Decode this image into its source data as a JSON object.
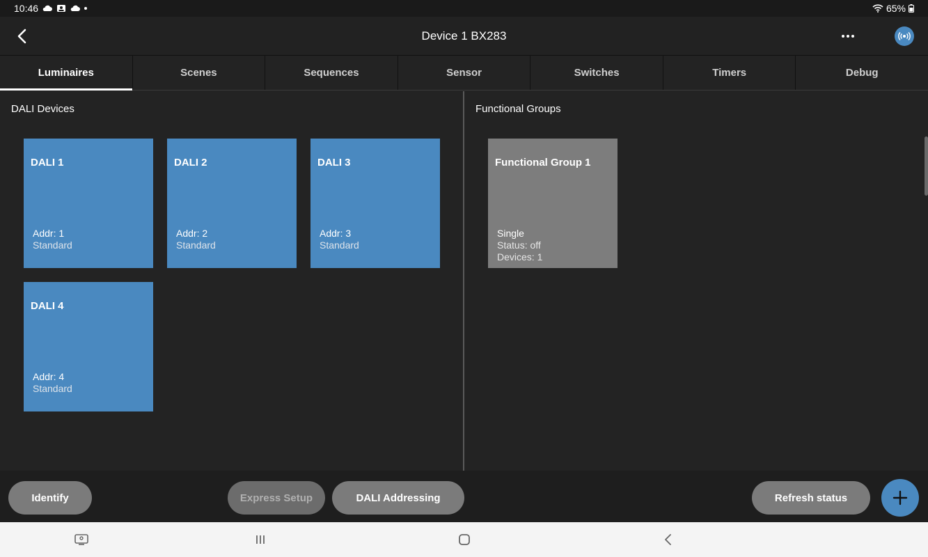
{
  "status_bar": {
    "time": "10:46",
    "battery": "65%"
  },
  "app_bar": {
    "title": "Device 1 BX283"
  },
  "tabs": [
    {
      "label": "Luminaires",
      "active": true
    },
    {
      "label": "Scenes"
    },
    {
      "label": "Sequences"
    },
    {
      "label": "Sensor"
    },
    {
      "label": "Switches"
    },
    {
      "label": "Timers"
    },
    {
      "label": "Debug"
    }
  ],
  "left_panel": {
    "title": "DALI Devices",
    "devices": [
      {
        "name": "DALI 1",
        "addr": "Addr: 1",
        "type": "Standard"
      },
      {
        "name": "DALI 2",
        "addr": "Addr: 2",
        "type": "Standard"
      },
      {
        "name": "DALI 3",
        "addr": "Addr: 3",
        "type": "Standard"
      },
      {
        "name": "DALI 4",
        "addr": "Addr: 4",
        "type": "Standard"
      }
    ]
  },
  "right_panel": {
    "title": "Functional Groups",
    "groups": [
      {
        "name": "Functional Group 1",
        "mode": "Single",
        "status": "Status: off",
        "devices": "Devices: 1"
      }
    ]
  },
  "bottom_bar": {
    "identify": "Identify",
    "express_setup": "Express Setup",
    "dali_addressing": "DALI Addressing",
    "refresh_status": "Refresh status"
  },
  "colors": {
    "accent": "#4a89c0",
    "tile_gray": "#7d7d7d",
    "background": "#232323"
  }
}
